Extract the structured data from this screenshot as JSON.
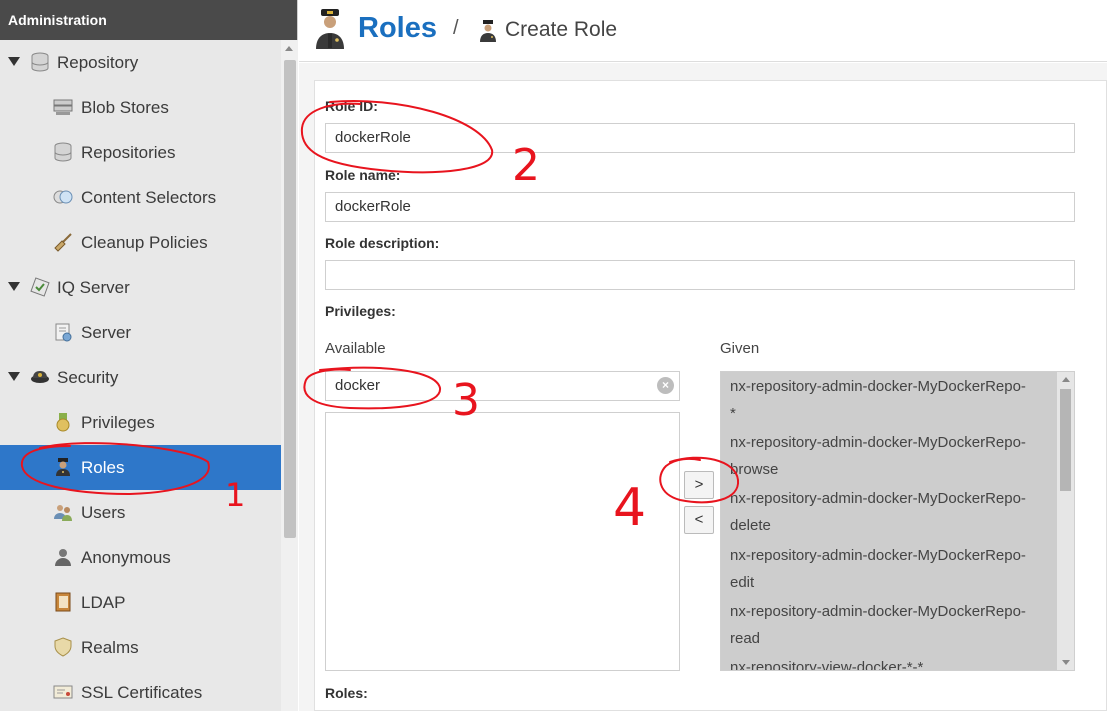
{
  "sidebar": {
    "header": "Administration",
    "items": [
      {
        "label": "Repository",
        "icon": "database-icon",
        "type": "group"
      },
      {
        "label": "Blob Stores",
        "icon": "server-icon",
        "type": "child"
      },
      {
        "label": "Repositories",
        "icon": "database-icon",
        "type": "child"
      },
      {
        "label": "Content Selectors",
        "icon": "selector-icon",
        "type": "child"
      },
      {
        "label": "Cleanup Policies",
        "icon": "broom-icon",
        "type": "child"
      },
      {
        "label": "IQ Server",
        "icon": "iq-server-icon",
        "type": "group"
      },
      {
        "label": "Server",
        "icon": "document-icon",
        "type": "child"
      },
      {
        "label": "Security",
        "icon": "police-hat-icon",
        "type": "group"
      },
      {
        "label": "Privileges",
        "icon": "medal-icon",
        "type": "child"
      },
      {
        "label": "Roles",
        "icon": "officer-icon",
        "type": "child",
        "selected": true
      },
      {
        "label": "Users",
        "icon": "users-icon",
        "type": "child"
      },
      {
        "label": "Anonymous",
        "icon": "anonymous-icon",
        "type": "child"
      },
      {
        "label": "LDAP",
        "icon": "address-book-icon",
        "type": "child"
      },
      {
        "label": "Realms",
        "icon": "shield-icon",
        "type": "child"
      },
      {
        "label": "SSL Certificates",
        "icon": "certificate-icon",
        "type": "child"
      }
    ]
  },
  "header": {
    "title": "Roles",
    "separator": "/",
    "breadcrumb": "Create Role"
  },
  "form": {
    "role_id_label": "Role ID:",
    "role_id_value": "dockerRole",
    "role_name_label": "Role name:",
    "role_name_value": "dockerRole",
    "role_description_label": "Role description:",
    "role_description_value": "",
    "privileges_label": "Privileges:",
    "available_label": "Available",
    "available_filter_value": "docker",
    "given_label": "Given",
    "given_items": [
      "nx-repository-admin-docker-MyDockerRepo-",
      "*",
      "nx-repository-admin-docker-MyDockerRepo-",
      "browse",
      "nx-repository-admin-docker-MyDockerRepo-",
      "delete",
      "nx-repository-admin-docker-MyDockerRepo-",
      "edit",
      "nx-repository-admin-docker-MyDockerRepo-",
      "read",
      "nx-repository-view-docker-*-*"
    ],
    "add_button": ">",
    "remove_button": "<",
    "clear_symbol": "×",
    "roles_label": "Roles:"
  },
  "annotations": [
    "1",
    "2",
    "3",
    "4"
  ],
  "colors": {
    "accent": "#2e77c9",
    "title": "#1a6fbf",
    "sidebar_header": "#4a4a4a",
    "annotation": "#e8141e"
  }
}
